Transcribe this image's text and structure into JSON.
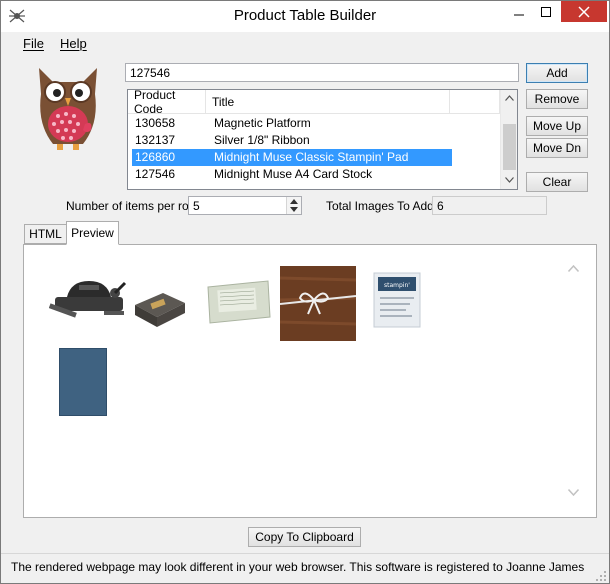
{
  "window": {
    "title": "Product Table Builder",
    "accent_close": "#c7372f"
  },
  "menu": {
    "file_label": "File",
    "help_label": "Help"
  },
  "product_input": {
    "value": "127546"
  },
  "buttons": {
    "add": "Add",
    "remove": "Remove",
    "move_up": "Move Up",
    "move_down": "Move Dn",
    "clear": "Clear",
    "copy": "Copy To Clipboard"
  },
  "product_list": {
    "columns": [
      "Product Code",
      "Title"
    ],
    "rows": [
      {
        "code": "130658",
        "title": "Magnetic Platform",
        "selected": false
      },
      {
        "code": "132137",
        "title": "Silver 1/8\" Ribbon",
        "selected": false
      },
      {
        "code": "126860",
        "title": "Midnight Muse Classic Stampin' Pad",
        "selected": true
      },
      {
        "code": "127546",
        "title": "Midnight Muse A4 Card Stock",
        "selected": false
      }
    ],
    "selection_color": "#3399ff"
  },
  "settings": {
    "items_per_row_label": "Number of items per row",
    "items_per_row_value": "5",
    "total_images_label": "Total Images To Add",
    "total_images_value": "6"
  },
  "tabs": {
    "html_label": "HTML",
    "preview_label": "Preview",
    "active": "Preview"
  },
  "preview_images": [
    {
      "name": "die-cutting-machine",
      "color": "#2e2e2e"
    },
    {
      "name": "punch-tool",
      "color": "#6e6a63"
    },
    {
      "name": "magnetic-platform",
      "color": "#cfd8c8"
    },
    {
      "name": "silver-ribbon-on-wood",
      "color": "#6b3d22"
    },
    {
      "name": "ink-pad",
      "color": "#eaeef2"
    },
    {
      "name": "card-stock",
      "color": "#3f6281"
    }
  ],
  "status": {
    "text": "The rendered webpage may look different in your web browser.  This software is registered to Joanne James"
  }
}
